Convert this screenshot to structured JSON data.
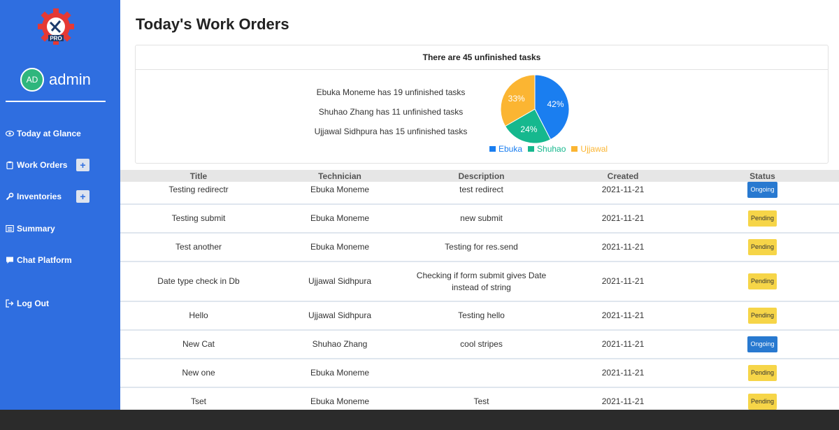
{
  "sidebar": {
    "logo_text": "MAINTENANCE PRO",
    "avatar_initials": "AD",
    "username": "admin",
    "items": [
      {
        "label": "Today at Glance",
        "icon": "eye-icon"
      },
      {
        "label": "Work Orders",
        "icon": "clipboard-icon",
        "has_add": true
      },
      {
        "label": "Inventories",
        "icon": "wrench-icon",
        "has_add": true
      },
      {
        "label": "Summary",
        "icon": "list-icon"
      },
      {
        "label": "Chat Platform",
        "icon": "chat-icon"
      },
      {
        "label": "Log Out",
        "icon": "logout-icon"
      }
    ],
    "add_label": "+"
  },
  "main": {
    "title": "Today's Work Orders",
    "summary_header": "There are 45 unfinished tasks",
    "stats": [
      "Ebuka Moneme has 19 unfinished tasks",
      "Shuhao Zhang has 11 unfinished tasks",
      "Ujjawal Sidhpura has 15 unfinished tasks"
    ]
  },
  "chart_data": {
    "type": "pie",
    "categories": [
      "Ebuka",
      "Shuhao",
      "Ujjawal"
    ],
    "values": [
      42,
      24,
      33
    ],
    "value_labels": [
      "42%",
      "24%",
      "33%"
    ],
    "colors": [
      "#1a7ef0",
      "#16b88e",
      "#fbb532"
    ],
    "legend": "bottom"
  },
  "table": {
    "columns": [
      "Title",
      "Technician",
      "Description",
      "Created",
      "Status"
    ],
    "rows": [
      {
        "title": "Testing redirectr",
        "technician": "Ebuka Moneme",
        "description": "test redirect",
        "created": "2021-11-21",
        "status": "Ongoing"
      },
      {
        "title": "Testing submit",
        "technician": "Ebuka Moneme",
        "description": "new submit",
        "created": "2021-11-21",
        "status": "Pending"
      },
      {
        "title": "Test another",
        "technician": "Ebuka Moneme",
        "description": "Testing for res.send",
        "created": "2021-11-21",
        "status": "Pending"
      },
      {
        "title": "Date type check in Db",
        "technician": "Ujjawal Sidhpura",
        "description": "Checking if form submit gives Date instead of string",
        "created": "2021-11-21",
        "status": "Pending"
      },
      {
        "title": "Hello",
        "technician": "Ujjawal Sidhpura",
        "description": "Testing hello",
        "created": "2021-11-21",
        "status": "Pending"
      },
      {
        "title": "New Cat",
        "technician": "Shuhao Zhang",
        "description": "cool stripes",
        "created": "2021-11-21",
        "status": "Ongoing"
      },
      {
        "title": "New one",
        "technician": "Ebuka Moneme",
        "description": "",
        "created": "2021-11-21",
        "status": "Pending"
      },
      {
        "title": "Tset",
        "technician": "Ebuka Moneme",
        "description": "Test",
        "created": "2021-11-21",
        "status": "Pending"
      }
    ]
  }
}
